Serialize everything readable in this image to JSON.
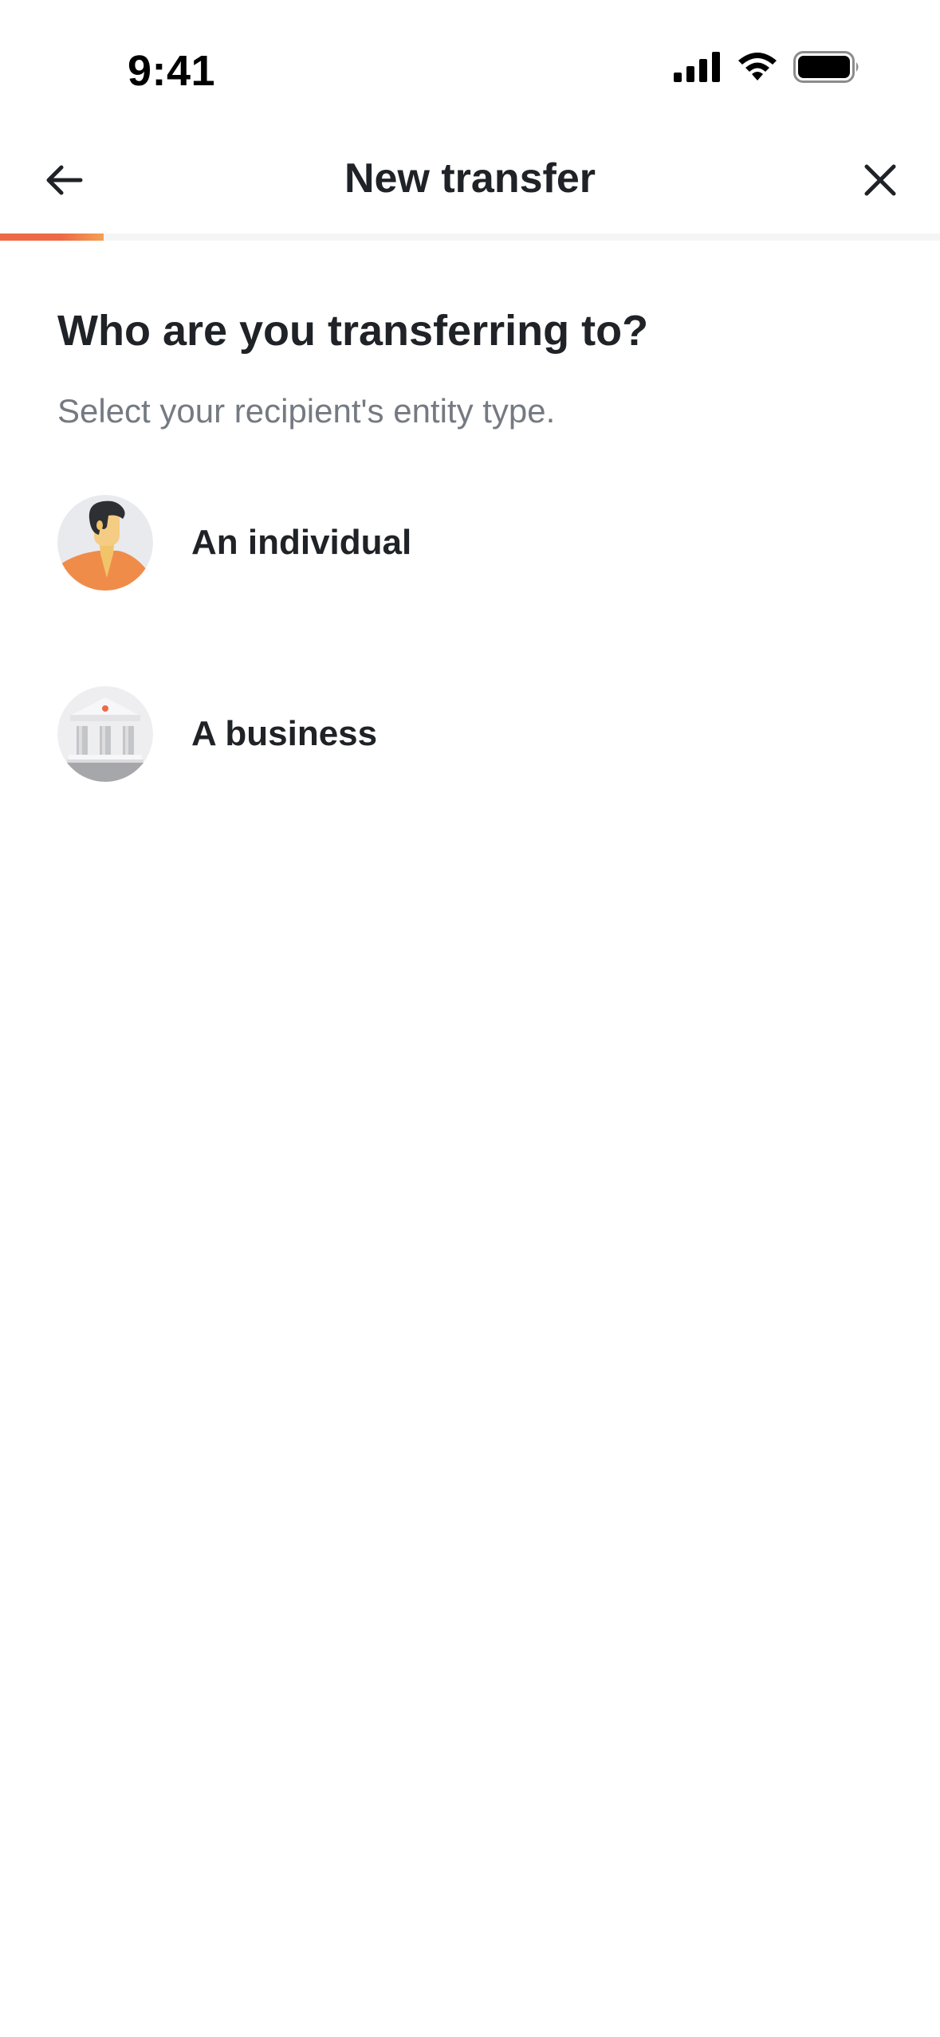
{
  "status_bar": {
    "time": "9:41",
    "icons": [
      "cellular-signal-icon",
      "wifi-icon",
      "battery-icon"
    ]
  },
  "nav": {
    "title": "New transfer",
    "back_icon": "arrow-left-icon",
    "close_icon": "close-icon"
  },
  "progress": {
    "fraction": 0.11,
    "colors": [
      "#ee6a47",
      "#f2a154"
    ]
  },
  "page": {
    "heading": "Who are you transferring to?",
    "subheading": "Select your recipient's entity type."
  },
  "options": [
    {
      "label": "An individual",
      "icon": "person-avatar-icon"
    },
    {
      "label": "A business",
      "icon": "bank-building-icon"
    }
  ],
  "colors": {
    "accent": "#ee6a47",
    "accent_light": "#f2a154",
    "text_primary": "#1f2226",
    "text_secondary": "#757a82"
  }
}
